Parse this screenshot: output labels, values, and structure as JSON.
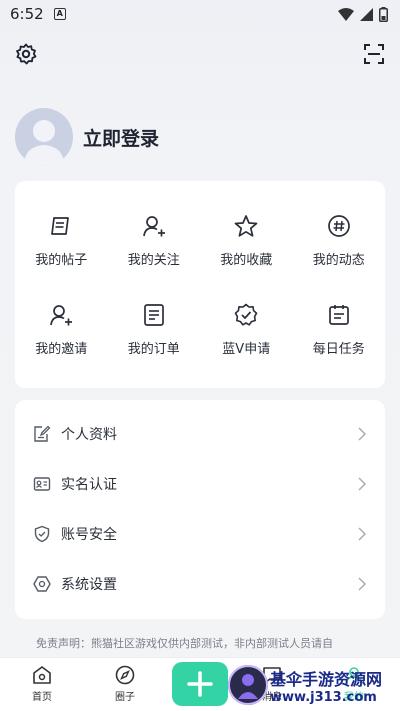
{
  "status_bar": {
    "time": "6:52",
    "notification_glyph": "A"
  },
  "top_bar": {
    "left_icon": "gear-icon",
    "right_icon": "scan-icon"
  },
  "profile": {
    "login_label": "立即登录"
  },
  "grid": [
    {
      "label": "我的帖子",
      "icon": "post-icon"
    },
    {
      "label": "我的关注",
      "icon": "follow-user-icon"
    },
    {
      "label": "我的收藏",
      "icon": "star-icon"
    },
    {
      "label": "我的动态",
      "icon": "hashtag-icon"
    },
    {
      "label": "我的邀请",
      "icon": "invite-user-icon"
    },
    {
      "label": "我的订单",
      "icon": "order-icon"
    },
    {
      "label": "蓝V申请",
      "icon": "verified-badge-icon"
    },
    {
      "label": "每日任务",
      "icon": "calendar-task-icon"
    }
  ],
  "menu": [
    {
      "label": "个人资料",
      "icon": "edit-profile-icon"
    },
    {
      "label": "实名认证",
      "icon": "id-card-icon"
    },
    {
      "label": "账号安全",
      "icon": "shield-icon"
    },
    {
      "label": "系统设置",
      "icon": "hexagon-settings-icon"
    }
  ],
  "disclaimer": "免责声明：熊猫社区游戏仅供内部测试，非内部测试人员请自",
  "tabbar": {
    "home": "首页",
    "circle": "圈子",
    "messages": "消息",
    "mine": "我的",
    "plus_icon": "plus-icon"
  },
  "watermark": {
    "title": "基伞手游资源网",
    "url": "www.j313.com"
  },
  "colors": {
    "accent": "#34d3a6",
    "watermark": "#1b2a8a"
  }
}
